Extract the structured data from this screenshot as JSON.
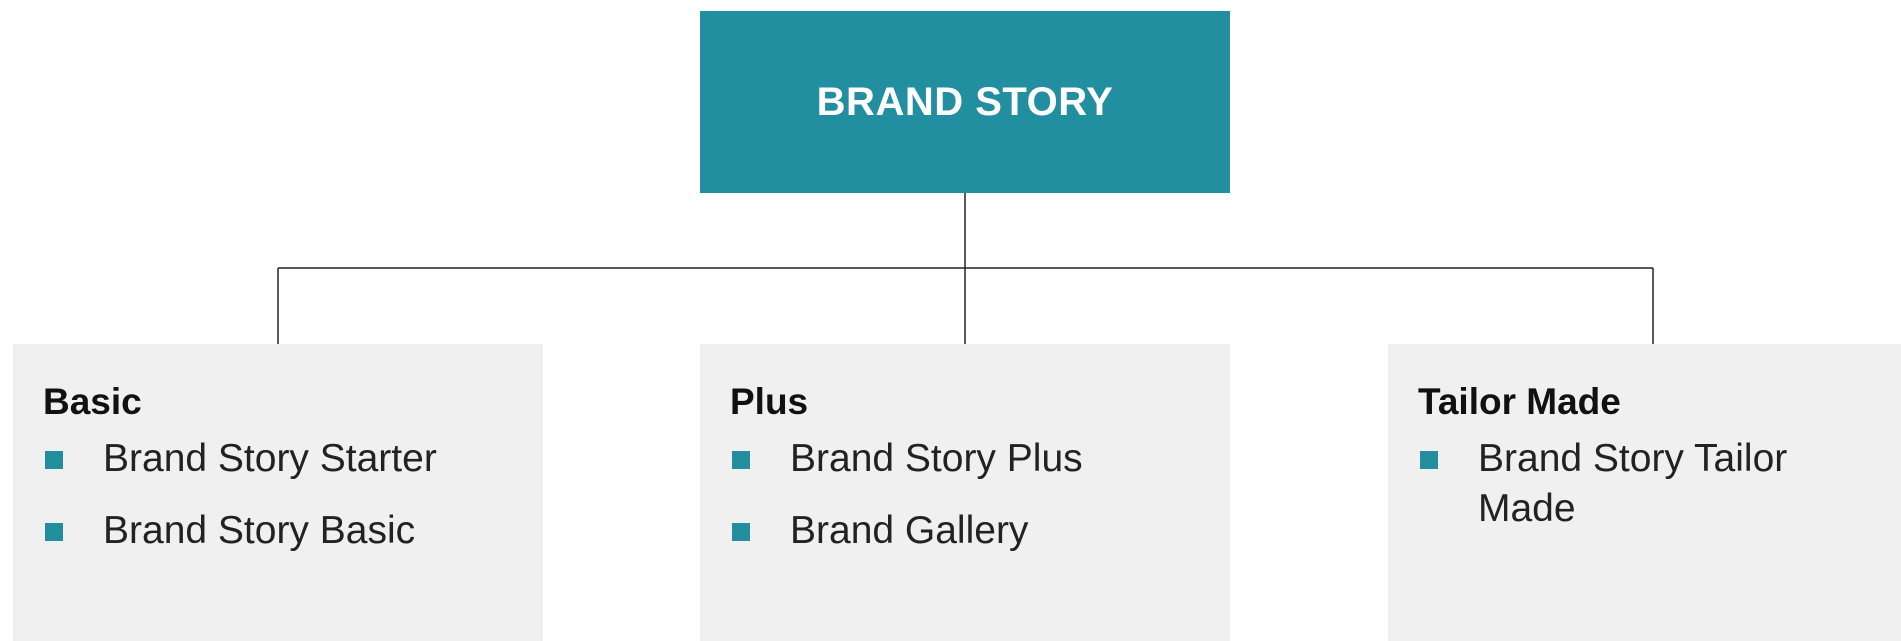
{
  "colors": {
    "accent": "#218f9f",
    "child_background": "#f0f0f0",
    "connector": "#222222"
  },
  "root": {
    "title": "BRAND STORY"
  },
  "children": [
    {
      "title": "Basic",
      "items": [
        "Brand Story Starter",
        "Brand Story Basic"
      ]
    },
    {
      "title": "Plus",
      "items": [
        "Brand Story Plus",
        "Brand Gallery"
      ]
    },
    {
      "title": "Tailor Made",
      "items": [
        "Brand Story Tailor Made"
      ]
    }
  ]
}
